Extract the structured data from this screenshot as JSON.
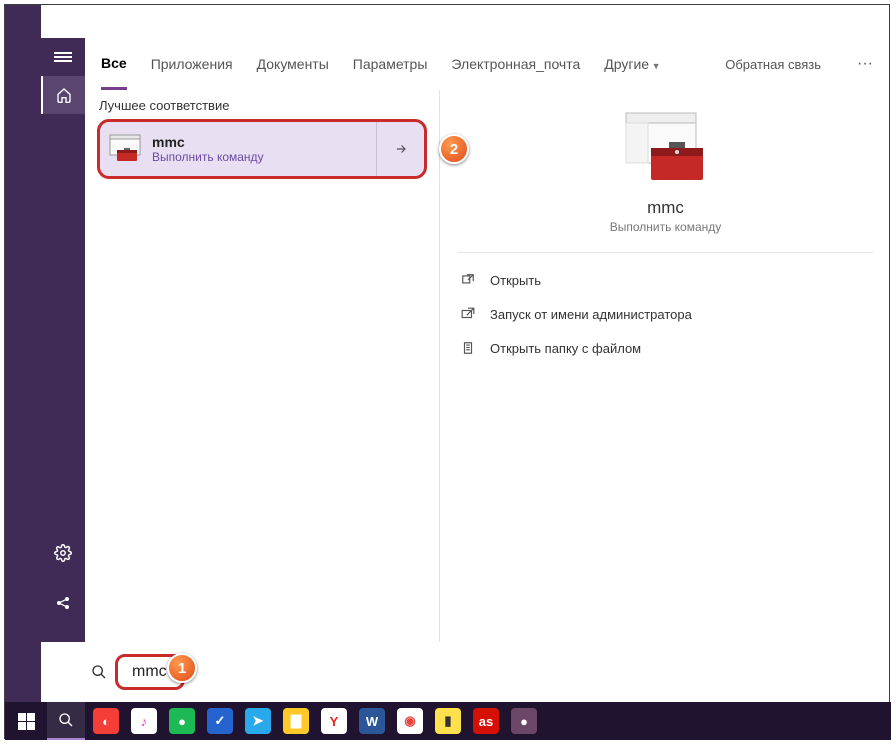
{
  "tabs": {
    "all": "Все",
    "apps": "Приложения",
    "documents": "Документы",
    "params": "Параметры",
    "email": "Электронная_почта",
    "other": "Другие"
  },
  "header": {
    "feedback": "Обратная связь",
    "more": "···"
  },
  "results": {
    "section_title": "Лучшее соответствие",
    "item": {
      "title": "mmc",
      "subtitle": "Выполнить команду"
    }
  },
  "preview": {
    "title": "mmc",
    "subtitle": "Выполнить команду",
    "actions": {
      "open": "Открыть",
      "run_admin": "Запуск от имени администратора",
      "open_folder": "Открыть папку с файлом"
    }
  },
  "search": {
    "query": "mmc"
  },
  "callouts": {
    "one": "1",
    "two": "2"
  },
  "icons": {
    "hamburger": "hamburger-icon",
    "home": "home-icon",
    "gear": "gear-icon",
    "share": "share-icon",
    "search": "search-icon",
    "arrow": "arrow-right-icon",
    "open": "open-icon",
    "admin": "admin-icon",
    "folder": "folder-icon",
    "windows": "windows-icon"
  },
  "taskbar_apps": [
    {
      "name": "pocketcasts",
      "color": "#f43e37",
      "label": "◐"
    },
    {
      "name": "itunes",
      "color": "#fff",
      "label": "♪",
      "text": "#e63abf"
    },
    {
      "name": "spotify",
      "color": "#1db954",
      "label": "●"
    },
    {
      "name": "todo",
      "color": "#2564cf",
      "label": "✓"
    },
    {
      "name": "telegram",
      "color": "#29a9ea",
      "label": "➤"
    },
    {
      "name": "explorer",
      "color": "#ffca28",
      "label": "▇"
    },
    {
      "name": "yandex",
      "color": "#fff",
      "label": "Y",
      "text": "#e52620"
    },
    {
      "name": "word",
      "color": "#2b579a",
      "label": "W"
    },
    {
      "name": "chrome",
      "color": "#fff",
      "label": "◉",
      "text": "#e8453c"
    },
    {
      "name": "notepad2",
      "color": "#ffe14d",
      "label": "▮",
      "text": "#333"
    },
    {
      "name": "lastfm",
      "color": "#d51007",
      "label": "as"
    },
    {
      "name": "record",
      "color": "#6b4668",
      "label": "●"
    }
  ]
}
